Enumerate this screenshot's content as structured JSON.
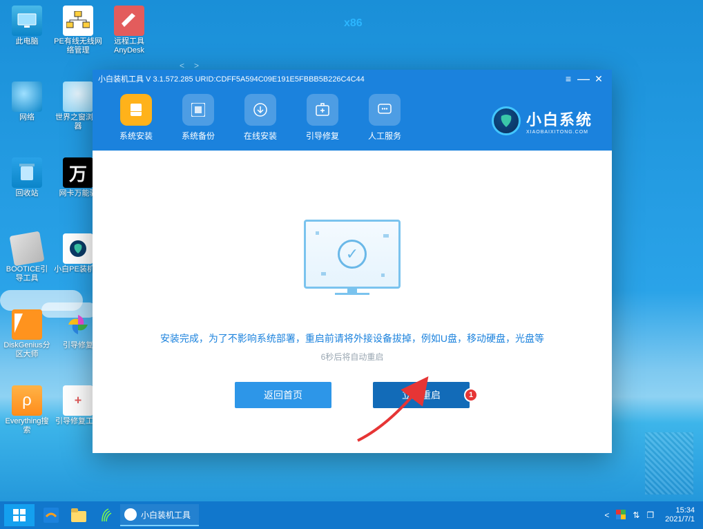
{
  "x86_label": "x86",
  "desktop_icons": [
    {
      "name": "this-pc",
      "label": "此电脑"
    },
    {
      "name": "pe-net",
      "label": "PE有线无线网络管理"
    },
    {
      "name": "anydesk",
      "label": "远程工具AnyDesk"
    },
    {
      "name": "network",
      "label": "网络"
    },
    {
      "name": "world-browser",
      "label": "世界之窗浏览器"
    },
    {
      "name": "recycle-bin",
      "label": "回收站"
    },
    {
      "name": "netcard-driver",
      "label": "网卡万能驱"
    },
    {
      "name": "bootice",
      "label": "BOOTICE引导工具"
    },
    {
      "name": "xiaobai-pe",
      "label": "小白PE装机具"
    },
    {
      "name": "diskgenius",
      "label": "DiskGenius分区大师"
    },
    {
      "name": "boot-repair",
      "label": "引导修复"
    },
    {
      "name": "everything",
      "label": "Everything搜索"
    },
    {
      "name": "repair-tools",
      "label": "引导修复工具"
    }
  ],
  "window": {
    "title": "小白装机工具 V 3.1.572.285 URID:CDFF5A594C09E191E5FBBB5B226C4C44",
    "toolbar": [
      {
        "id": "install",
        "label": "系统安装"
      },
      {
        "id": "backup",
        "label": "系统备份"
      },
      {
        "id": "online",
        "label": "在线安装"
      },
      {
        "id": "bootfix",
        "label": "引导修复"
      },
      {
        "id": "support",
        "label": "人工服务"
      }
    ],
    "brand_cn": "小白系统",
    "brand_en": "XIAOBAIXITONG.COM",
    "message": "安装完成，为了不影响系统部署，重启前请将外接设备拔掉，例如U盘，移动硬盘，光盘等",
    "countdown": "6秒后将自动重启",
    "btn_home": "返回首页",
    "btn_restart": "立即重启",
    "callout_number": "1"
  },
  "taskbar": {
    "task_label": "小白装机工具",
    "time": "15:34",
    "date": "2021/7/1"
  }
}
